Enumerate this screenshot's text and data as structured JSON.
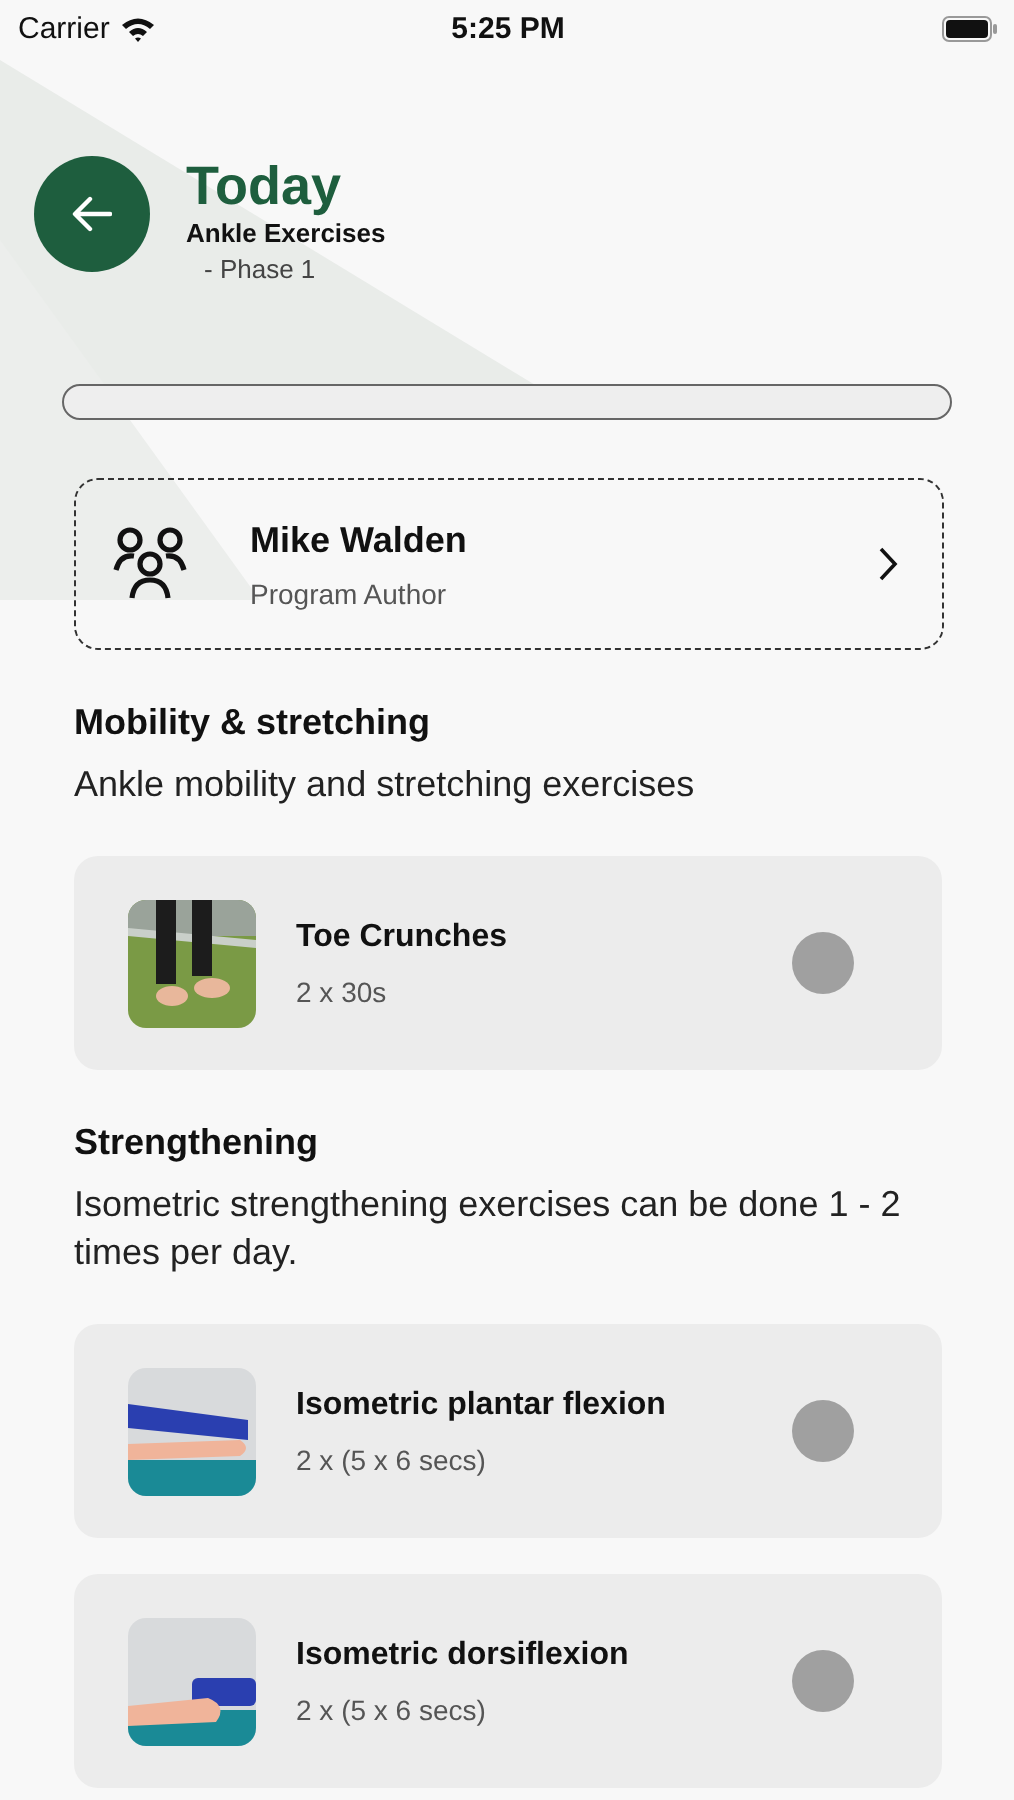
{
  "status_bar": {
    "carrier": "Carrier",
    "time": "5:25 PM"
  },
  "header": {
    "title": "Today",
    "subtitle": "Ankle Exercises",
    "phase": "- Phase 1"
  },
  "progress": {
    "level": 0
  },
  "author": {
    "name": "Mike Walden",
    "role": "Program Author"
  },
  "sections": [
    {
      "title": "Mobility & stretching",
      "description": "Ankle mobility and stretching exercises",
      "exercises": [
        {
          "name": "Toe Crunches",
          "dose": "2 x 30s",
          "checked": false
        }
      ]
    },
    {
      "title": "Strengthening",
      "description": "Isometric strengthening exercises can be done 1 - 2 times per day.",
      "exercises": [
        {
          "name": "Isometric plantar flexion",
          "dose": "2 x (5 x 6 secs)",
          "checked": false
        },
        {
          "name": "Isometric dorsiflexion",
          "dose": "2 x (5 x 6 secs)",
          "checked": false
        }
      ]
    }
  ]
}
